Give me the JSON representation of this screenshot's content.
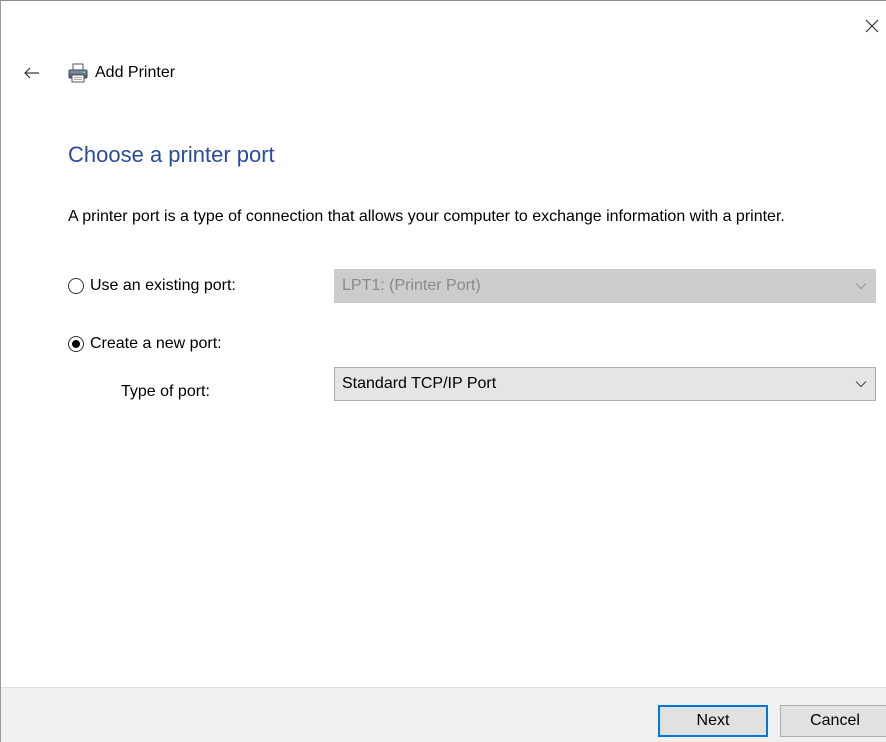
{
  "window": {
    "title": "Add Printer",
    "close_icon": "close-icon",
    "back_icon": "back-arrow-icon",
    "app_icon": "printer-icon"
  },
  "page": {
    "heading": "Choose a printer port",
    "description": "A printer port is a type of connection that allows your computer to exchange information with a printer."
  },
  "options": {
    "existing_port": {
      "label": "Use an existing port:",
      "selected": false,
      "value": "LPT1: (Printer Port)",
      "enabled": false
    },
    "new_port": {
      "label": "Create a new port:",
      "selected": true,
      "type_label": "Type of port:",
      "value": "Standard TCP/IP Port",
      "enabled": true
    }
  },
  "footer": {
    "next_label": "Next",
    "cancel_label": "Cancel"
  },
  "colors": {
    "heading": "#2b4c9b",
    "default_button_border": "#0078d7",
    "footer_bg": "#f0f0f0"
  }
}
